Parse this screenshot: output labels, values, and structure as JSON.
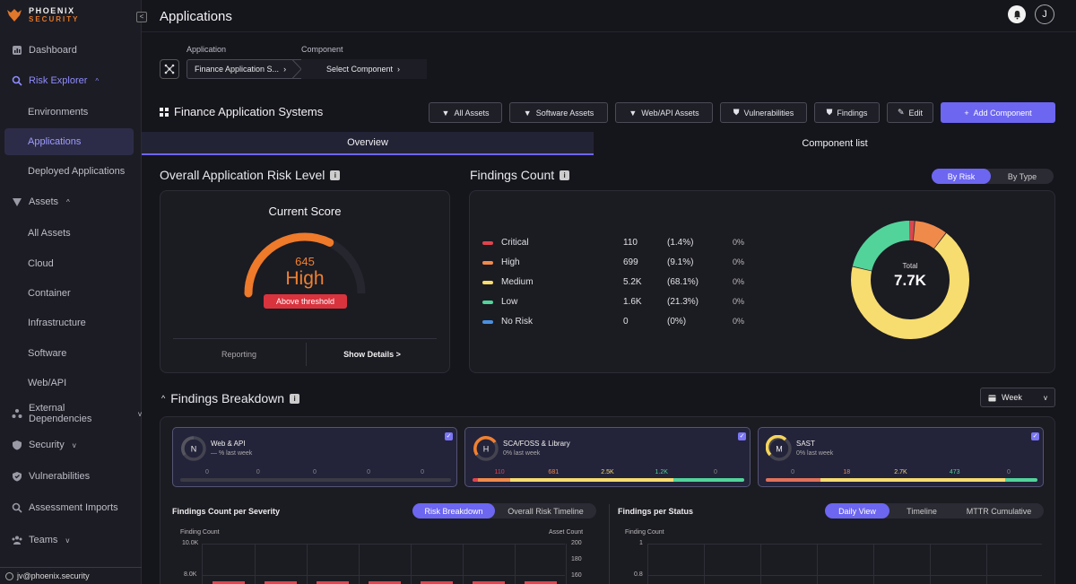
{
  "brand": {
    "line1": "PHOENIX",
    "line2": "SECURITY"
  },
  "sidebar": {
    "items": [
      {
        "label": "Dashboard"
      },
      {
        "label": "Risk Explorer"
      },
      {
        "label": "Environments"
      },
      {
        "label": "Applications"
      },
      {
        "label": "Deployed Applications"
      },
      {
        "label": "Assets"
      },
      {
        "label": "All Assets"
      },
      {
        "label": "Cloud"
      },
      {
        "label": "Container"
      },
      {
        "label": "Infrastructure"
      },
      {
        "label": "Software"
      },
      {
        "label": "Web/API"
      },
      {
        "label": "External Dependencies"
      },
      {
        "label": "Security"
      },
      {
        "label": "Vulnerabilities"
      },
      {
        "label": "Assessment Imports"
      },
      {
        "label": "Teams"
      }
    ],
    "user_email": "jv@phoenix.security"
  },
  "header": {
    "title": "Applications",
    "avatar_initial": "J"
  },
  "breadcrumb": {
    "application_label": "Application",
    "application_value": "Finance Application S...",
    "component_label": "Component",
    "component_value": "Select Component"
  },
  "app": {
    "title": "Finance Application Systems",
    "buttons": {
      "all_assets": "All Assets",
      "software_assets": "Software Assets",
      "web_api_assets": "Web/API Assets",
      "vulnerabilities": "Vulnerabilities",
      "findings": "Findings",
      "edit": "Edit",
      "add_component": "Add Component"
    }
  },
  "tabs": {
    "overview": "Overview",
    "component_list": "Component list"
  },
  "risk": {
    "title": "Overall Application Risk Level",
    "card_title": "Current Score",
    "score": "645",
    "level": "High",
    "threshold": "Above threshold",
    "reporting": "Reporting",
    "show_details": "Show Details >",
    "gauge_fraction": 0.645
  },
  "findings_count": {
    "title": "Findings Count",
    "toggle": {
      "by_risk": "By Risk",
      "by_type": "By Type"
    },
    "rows": [
      {
        "name": "Critical",
        "count": "110",
        "pct": "(1.4%)",
        "change": "0%",
        "color": "#e0444e"
      },
      {
        "name": "High",
        "count": "699",
        "pct": "(9.1%)",
        "change": "0%",
        "color": "#f08a4b"
      },
      {
        "name": "Medium",
        "count": "5.2K",
        "pct": "(68.1%)",
        "change": "0%",
        "color": "#f7dc6f"
      },
      {
        "name": "Low",
        "count": "1.6K",
        "pct": "(21.3%)",
        "change": "0%",
        "color": "#52d39a"
      },
      {
        "name": "No Risk",
        "count": "0",
        "pct": "(0%)",
        "change": "0%",
        "color": "#4a90e2"
      }
    ],
    "total_label": "Total",
    "total_value": "7.7K"
  },
  "breakdown": {
    "title": "Findings Breakdown",
    "period": "Week",
    "cards": [
      {
        "badge": "N",
        "name": "Web & API",
        "sub": "— % last week",
        "values": [
          "0",
          "0",
          "0",
          "0",
          "0"
        ],
        "badge_color": "#555560"
      },
      {
        "badge": "H",
        "name": "SCA/FOSS & Library",
        "sub": "0% last week",
        "values": [
          "110",
          "681",
          "2.5K",
          "1.2K",
          "0"
        ],
        "badge_color": "#f08030"
      },
      {
        "badge": "M",
        "name": "SAST",
        "sub": "0% last week",
        "values": [
          "0",
          "18",
          "2.7K",
          "473",
          "0"
        ],
        "badge_color": "#f5d45a"
      }
    ]
  },
  "severity_chart": {
    "title": "Findings Count per Severity",
    "toggle": {
      "a": "Risk Breakdown",
      "b": "Overall Risk Timeline"
    },
    "y_left_label": "Finding Count",
    "y_right_label": "Asset Count",
    "y_left_ticks": [
      "10.0K",
      "8.0K"
    ],
    "y_right_ticks": [
      "200",
      "180",
      "160"
    ]
  },
  "status_chart": {
    "title": "Findings per Status",
    "toggle": {
      "a": "Daily View",
      "b": "Timeline",
      "c": "MTTR Cumulative"
    },
    "y_label": "Finding Count",
    "y_ticks": [
      "1",
      "0.8"
    ]
  }
}
